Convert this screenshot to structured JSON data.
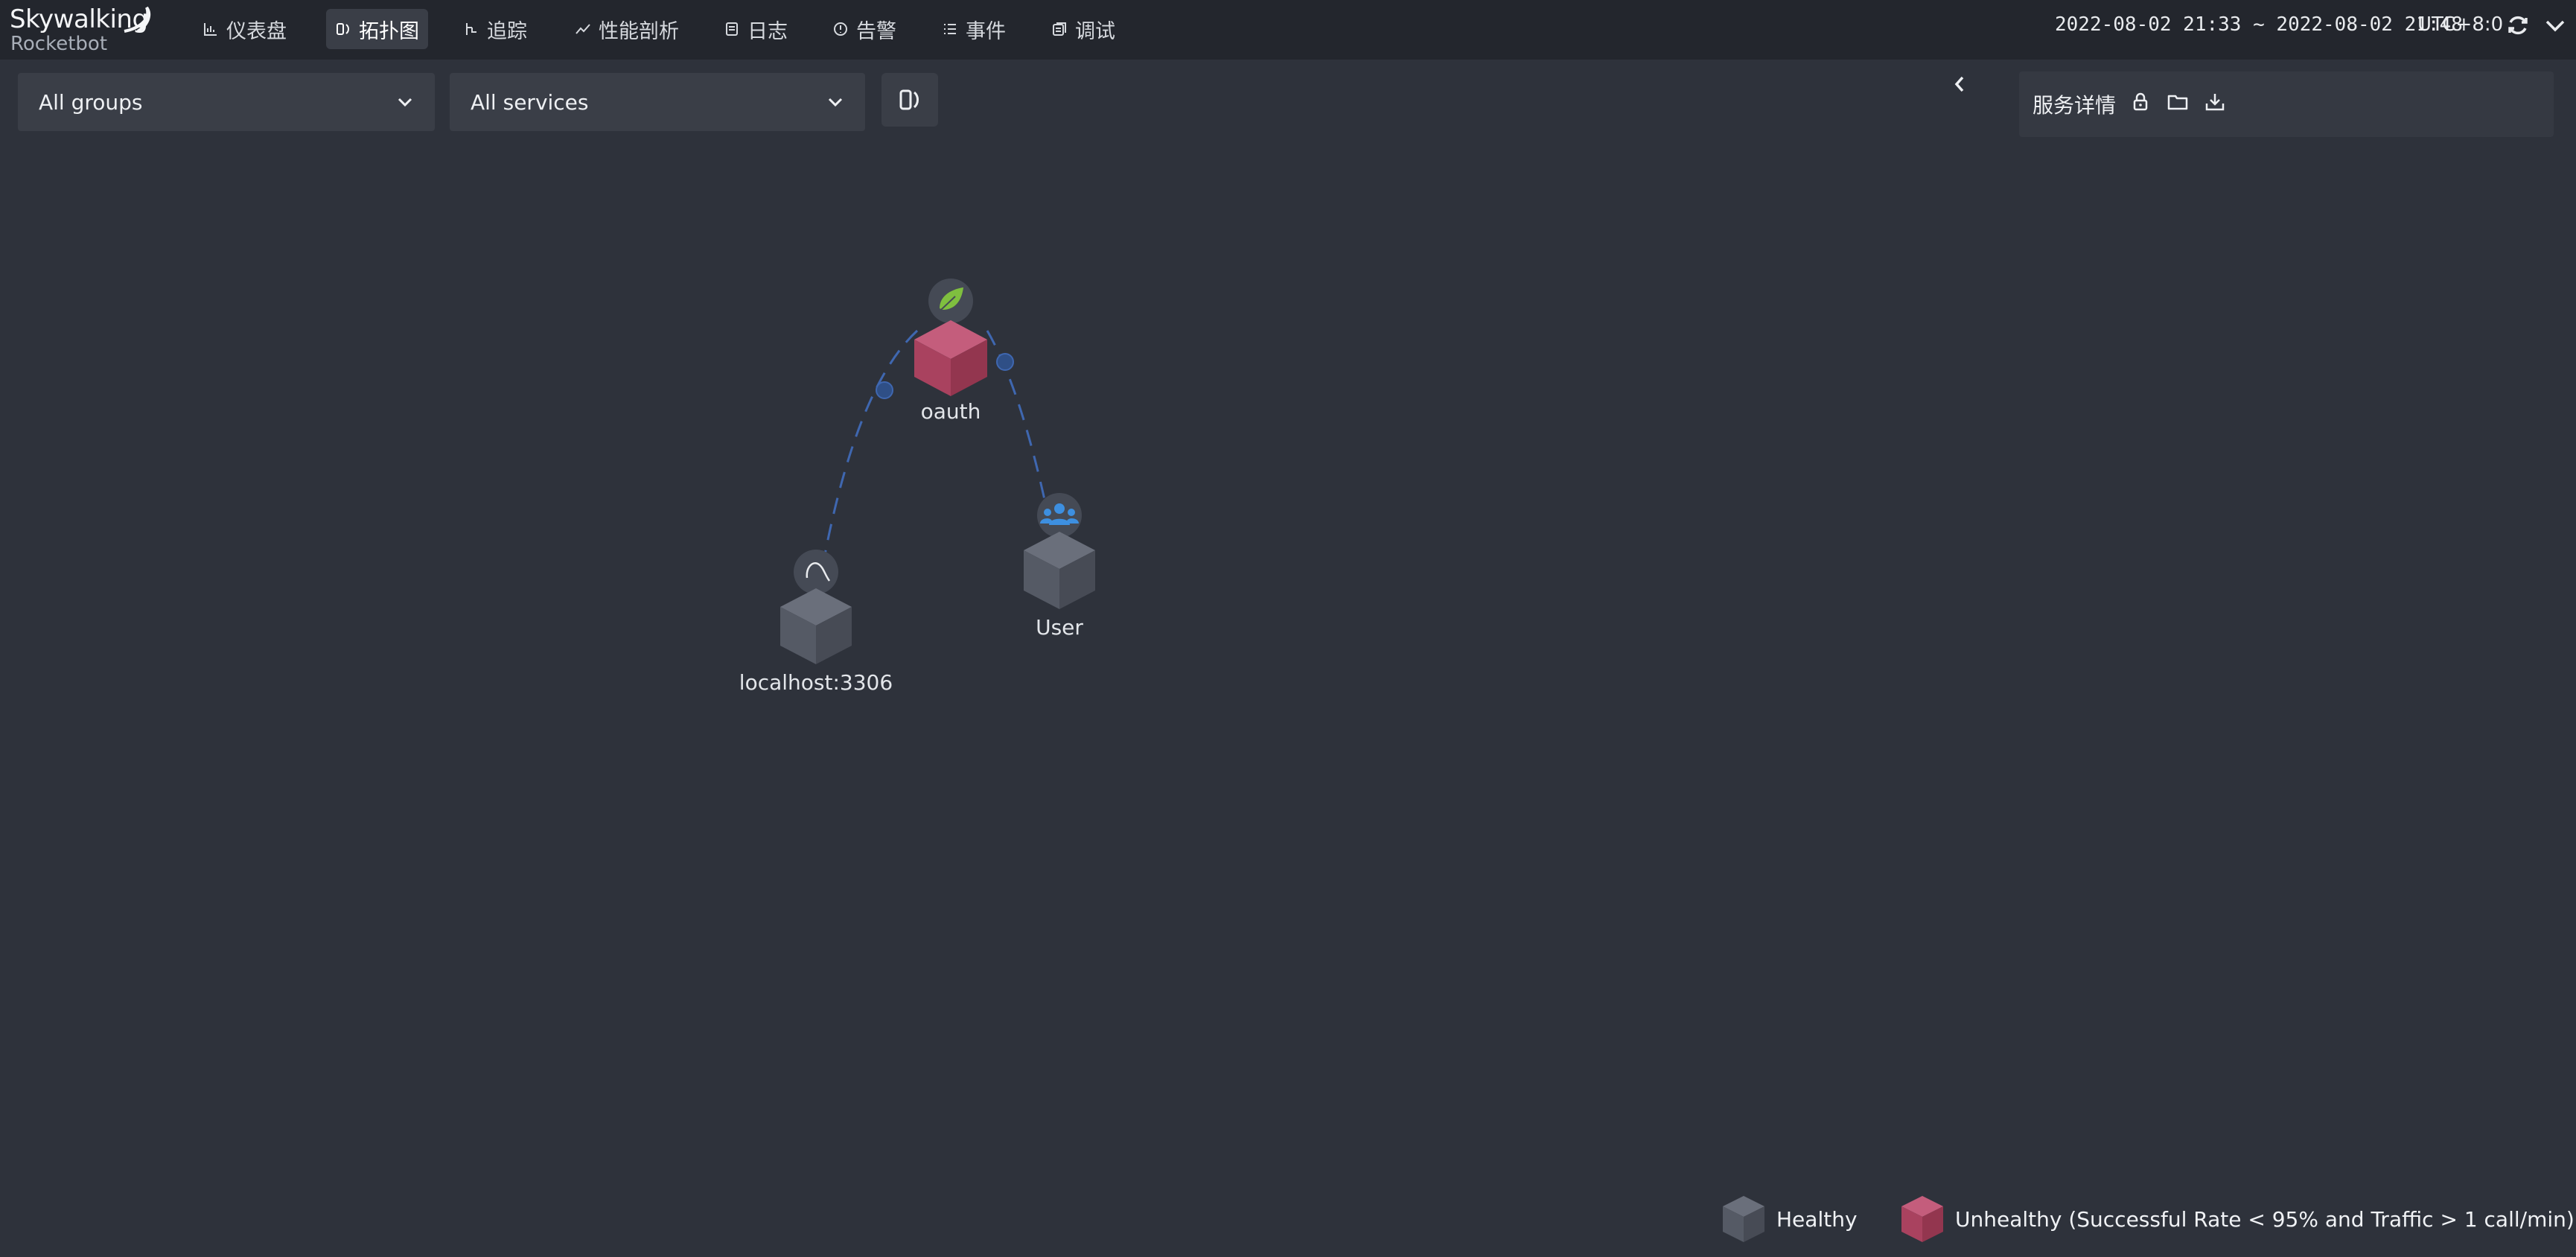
{
  "app": {
    "logo_main": "Skywalking",
    "logo_sub": "Rocketbot"
  },
  "nav": [
    {
      "label": "仪表盘",
      "icon": "chart-icon"
    },
    {
      "label": "拓扑图",
      "icon": "topology-icon",
      "active": true
    },
    {
      "label": "追踪",
      "icon": "trace-icon"
    },
    {
      "label": "性能剖析",
      "icon": "profile-icon"
    },
    {
      "label": "日志",
      "icon": "log-icon"
    },
    {
      "label": "告警",
      "icon": "alarm-icon"
    },
    {
      "label": "事件",
      "icon": "event-icon"
    },
    {
      "label": "调试",
      "icon": "debug-icon"
    }
  ],
  "header": {
    "time_range": "2022-08-02 21:33 ~ 2022-08-02 21:48",
    "timezone": "UTC+8:0"
  },
  "filters": {
    "group_selected": "All groups",
    "service_selected": "All services"
  },
  "detail_panel": {
    "title": "服务详情",
    "icons": [
      "lock-icon",
      "folder-icon",
      "download-icon"
    ]
  },
  "topology": {
    "nodes": [
      {
        "name": "oauth",
        "status": "unhealthy",
        "type_icon": "spring-leaf-icon"
      },
      {
        "name": "localhost:3306",
        "status": "healthy",
        "type_icon": "mysql-icon"
      },
      {
        "name": "User",
        "status": "healthy",
        "type_icon": "users-icon"
      }
    ],
    "edges": [
      {
        "source": "oauth",
        "target": "localhost:3306"
      },
      {
        "source": "oauth",
        "target": "User"
      }
    ]
  },
  "legend": {
    "healthy": "Healthy",
    "unhealthy": "Unhealthy (Successful Rate < 95% and Traffic > 1 call/min)"
  },
  "colors": {
    "healthy_node": "#5a5f6b",
    "unhealthy_node": "#b44d6b",
    "edge": "#3f67b0",
    "spring_green": "#7fbf3f",
    "users_blue": "#3d8fe0"
  }
}
